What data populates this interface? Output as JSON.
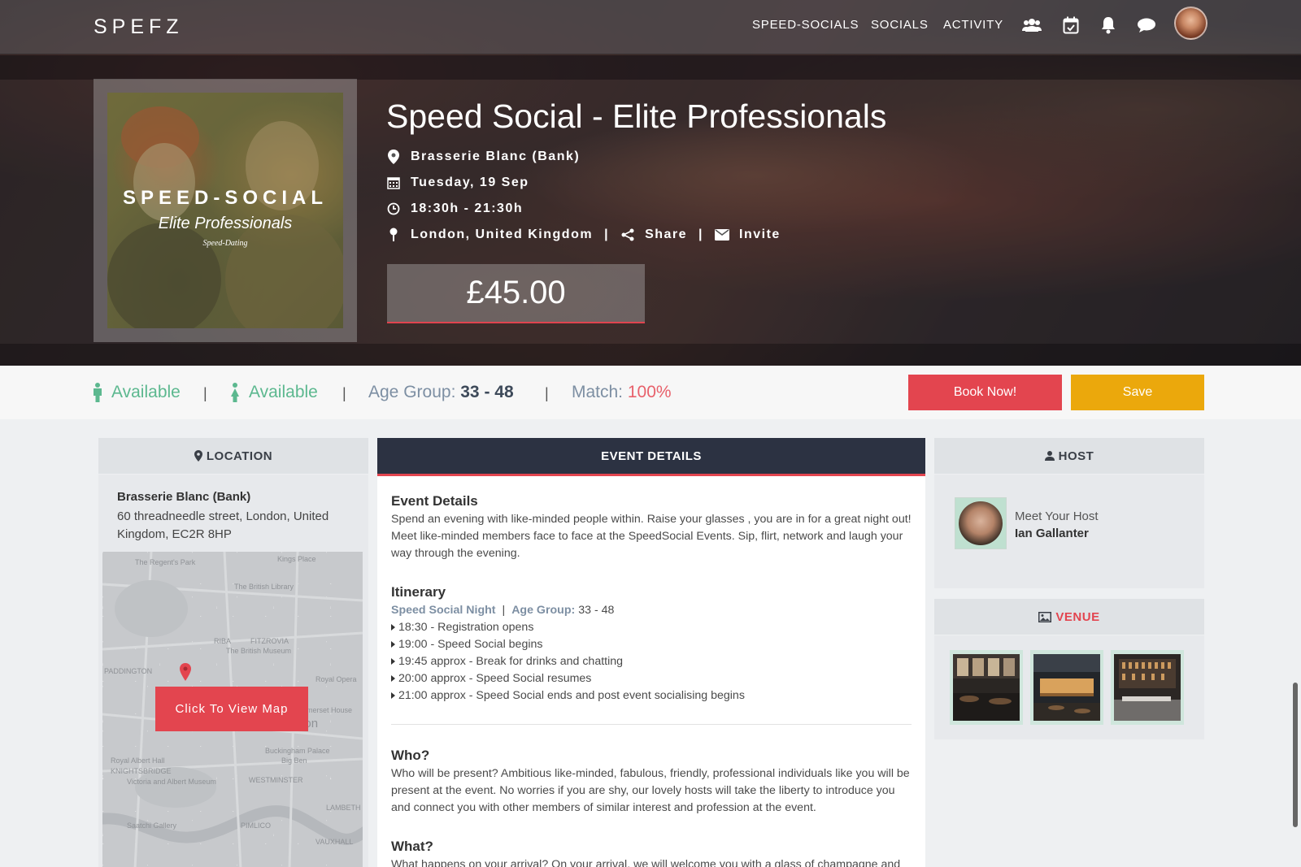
{
  "nav": {
    "logo": "SPEFZ",
    "links": [
      "SPEED-SOCIALS",
      "SOCIALS",
      "ACTIVITY"
    ],
    "icons": [
      "users-icon",
      "calendar-check-icon",
      "bell-icon",
      "chat-bubble-icon"
    ]
  },
  "poster": {
    "title": "SPEED-SOCIAL",
    "subtitle": "Elite Professionals",
    "tagline": "Speed-Dating"
  },
  "event": {
    "title": "Speed Social - Elite Professionals",
    "venue": "Brasserie Blanc (Bank)",
    "date": "Tuesday, 19 Sep",
    "time": "18:30h - 21:30h",
    "city": "London, United Kingdom",
    "share_label": "Share",
    "invite_label": "Invite",
    "price": "£45.00"
  },
  "status": {
    "male_availability": "Available",
    "female_availability": "Available",
    "age_group_label": "Age Group:",
    "age_group_value": "33 - 48",
    "match_label": "Match:",
    "match_value": "100%",
    "book_label": "Book Now!",
    "save_label": "Save"
  },
  "location": {
    "heading": "LOCATION",
    "name": "Brasserie Blanc (Bank)",
    "address": "60 threadneedle street, London, United Kingdom, EC2R 8HP",
    "map_button": "Click To View Map",
    "map_labels": [
      "The Regent's Park",
      "The British Library",
      "FITZROVIA",
      "The British Museum",
      "RIBA",
      "Kings Place",
      "PADDINGTON",
      "Royal Opera",
      "Somerset House",
      "London",
      "Buckingham Palace",
      "Big Ben",
      "Royal Albert Hall",
      "KNIGHTSBRIDGE",
      "Victoria and Albert Museum",
      "WESTMINSTER",
      "LAMBETH",
      "Saatchi Gallery",
      "PIMLICO",
      "VAUXHALL"
    ]
  },
  "details": {
    "heading": "EVENT DETAILS",
    "section1_title": "Event Details",
    "section1_text": "Spend an evening with like-minded people within. Raise your glasses , you are in for a great night out! Meet like-minded members face to face at the SpeedSocial Events. Sip, flirt, network and laugh your way through the evening.",
    "itinerary_title": "Itinerary",
    "itinerary_night": "Speed Social Night",
    "itinerary_sep": "|",
    "itinerary_age_label": "Age Group:",
    "itinerary_age_value": "33 - 48",
    "itinerary": [
      "18:30 - Registration opens",
      "19:00 - Speed Social begins",
      "19:45 approx - Break for drinks and chatting",
      "20:00 approx - Speed Social resumes",
      "21:00 approx - Speed Social ends and post event socialising begins"
    ],
    "who_title": "Who?",
    "who_text": "Who will be present? Ambitious like-minded, fabulous, friendly, professional individuals like you will be present at the event. No worries if you are shy, our lovely hosts will take the liberty to introduce you and connect you with other members of similar interest and profession at the event.",
    "what_title": "What?",
    "what_text": "What happens on your arrival? On your arrival, we will welcome you with a glass of champagne and"
  },
  "host": {
    "heading": "HOST",
    "meet_label": "Meet Your Host",
    "name": "Ian Gallanter"
  },
  "venue": {
    "heading": "VENUE"
  },
  "colors": {
    "accent_red": "#e3454f",
    "accent_yellow": "#eba80c",
    "available_green": "#5cb88f",
    "nav_dark": "#2c3242"
  }
}
